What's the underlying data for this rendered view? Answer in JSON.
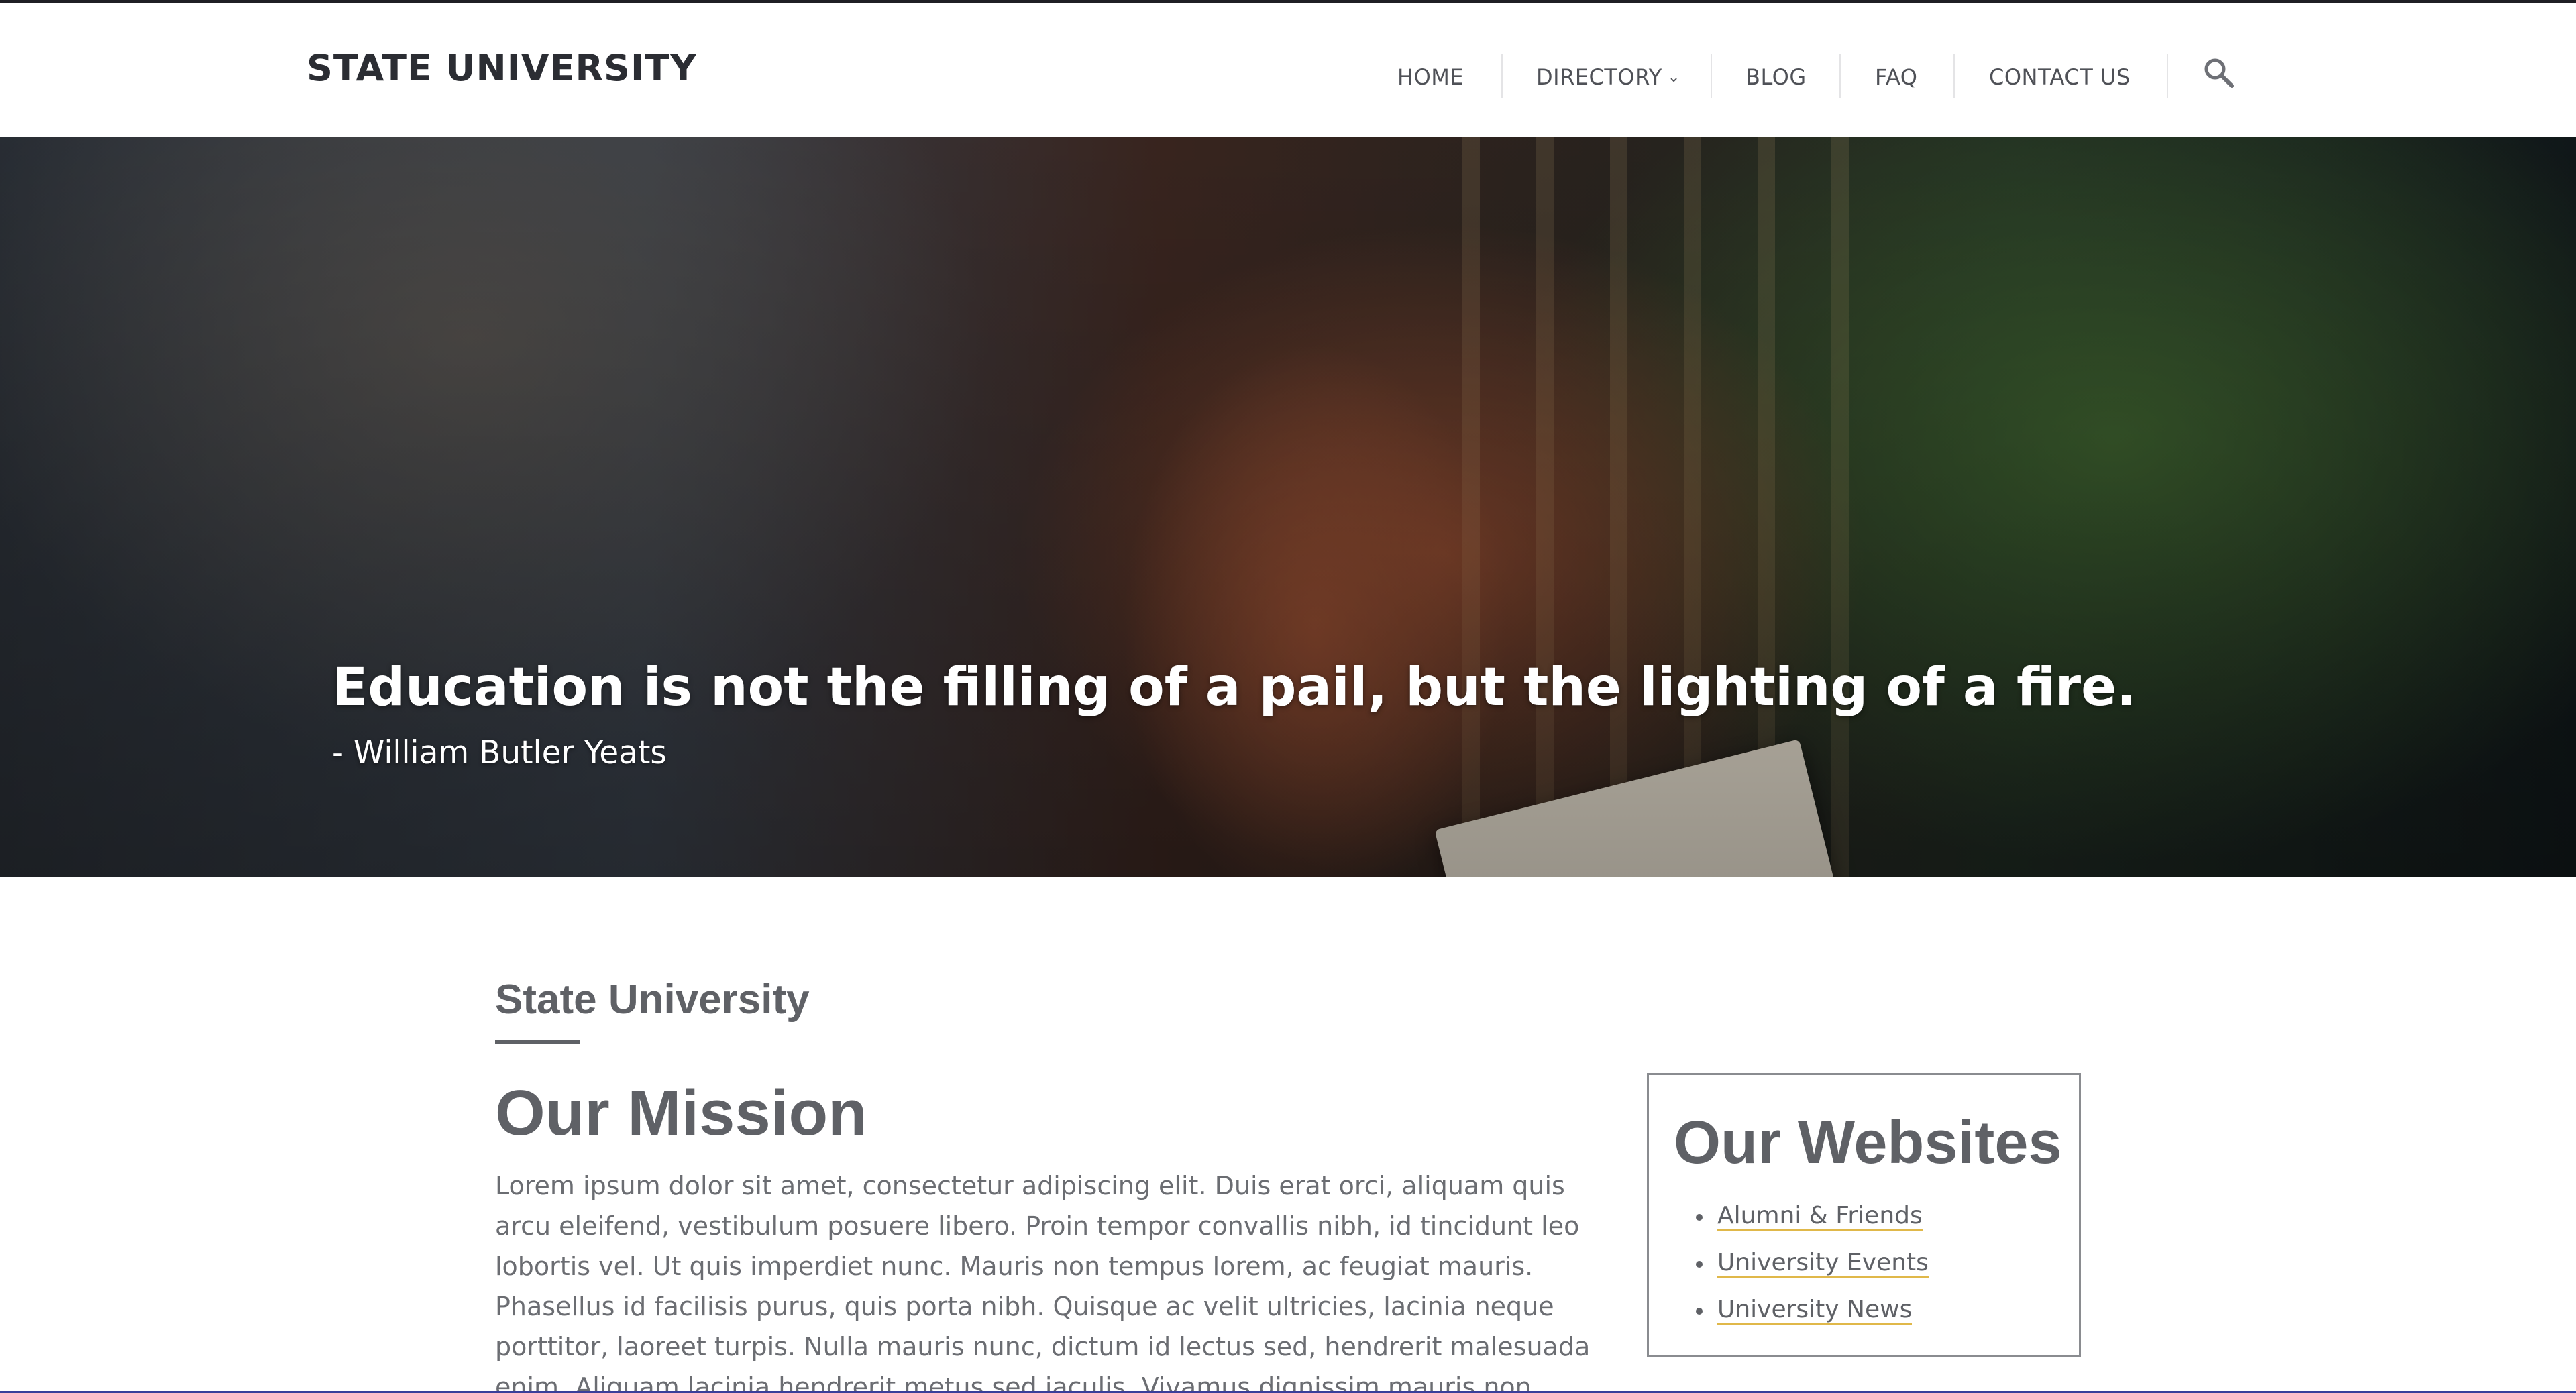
{
  "header": {
    "brand": "STATE UNIVERSITY",
    "nav": [
      {
        "label": "HOME"
      },
      {
        "label": "DIRECTORY"
      },
      {
        "label": "BLOG"
      },
      {
        "label": "FAQ"
      },
      {
        "label": "CONTACT US"
      }
    ],
    "search_icon": "search-icon",
    "directory_icon": "chevron-down-icon"
  },
  "hero": {
    "quote": "Education is not the filling of a pail, but the lighting of a fire.",
    "author": "- William Butler Yeats"
  },
  "content": {
    "kicker": "State University",
    "mission_title": "Our Mission",
    "mission_text": "Lorem ipsum dolor sit amet, consectetur adipiscing elit. Duis erat orci, aliquam quis arcu eleifend, vestibulum posuere libero. Proin tempor convallis nibh, id tincidunt leo lobortis vel. Ut quis imperdiet nunc. Mauris non tempus lorem, ac feugiat mauris. Phasellus id facilisis purus, quis porta nibh. Quisque ac velit ultricies, lacinia neque porttitor, laoreet turpis. Nulla mauris nunc, dictum id lectus sed, hendrerit malesuada enim. Aliquam lacinia hendrerit metus sed iaculis. Vivamus dignissim mauris non sapien commodo, non tempor magna imperdiet."
  },
  "sidebar": {
    "title": "Our Websites",
    "links": [
      {
        "label": "Alumni & Friends"
      },
      {
        "label": "University Events"
      },
      {
        "label": "University News"
      }
    ]
  },
  "colors": {
    "text": "#5f6166",
    "link_underline": "#e0b84a",
    "header_rule": "#1f1f24"
  }
}
